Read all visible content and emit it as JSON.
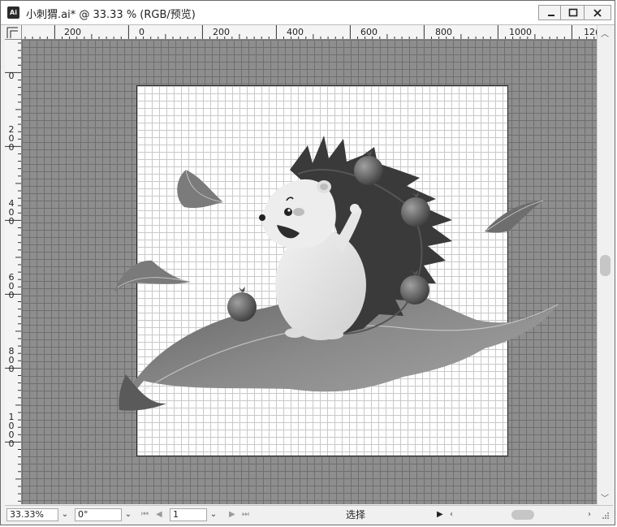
{
  "window": {
    "app_icon": "Ai",
    "title": "小刺猬.ai* @ 33.33 % (RGB/预览)",
    "controls": [
      "minimize-icon",
      "maximize-icon",
      "close-icon"
    ]
  },
  "ruler_top": {
    "labels": [
      "200",
      "0",
      "200",
      "400",
      "600",
      "800",
      "1000",
      "12("
    ]
  },
  "ruler_left": {
    "labels": [
      "0",
      "200",
      "400",
      "600",
      "800",
      "1000"
    ]
  },
  "status_bar": {
    "zoom": "33.33%",
    "rotation": "0°",
    "artboard_number": "1",
    "current_tool": "选择",
    "icons": [
      "first-page-icon",
      "prev-page-icon",
      "next-page-icon",
      "last-page-icon",
      "play-icon",
      "resize-grip-icon"
    ]
  },
  "colors": {
    "pasteboard": "#8e8e8e",
    "artboard": "#ffffff",
    "grid": "#c9c9c9"
  }
}
